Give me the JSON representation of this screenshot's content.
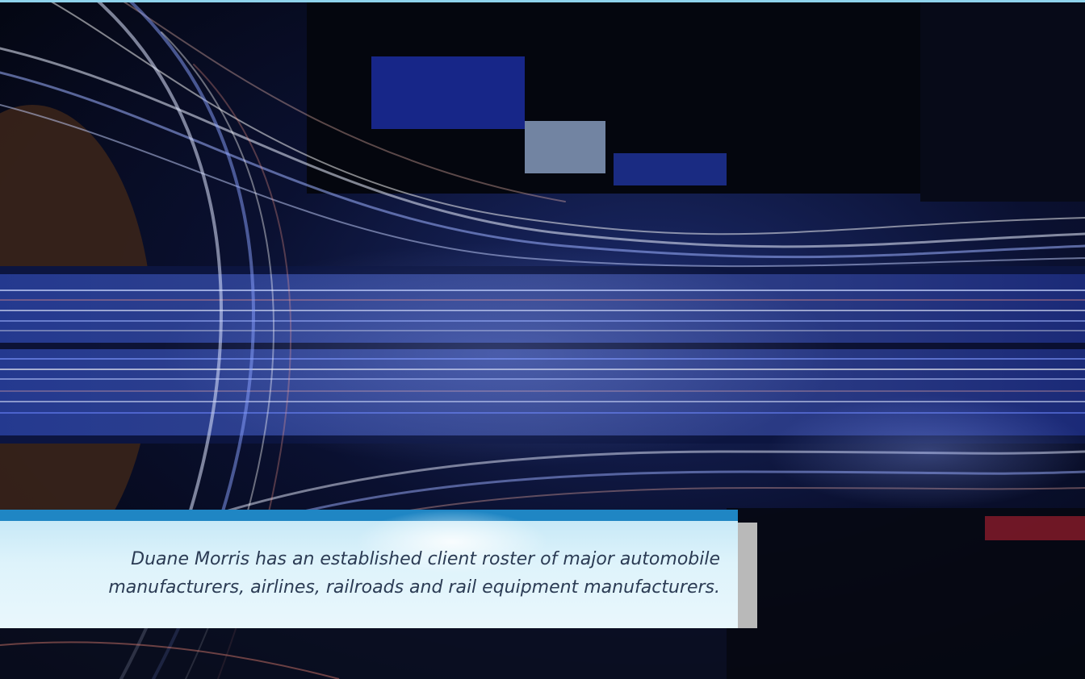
{
  "quote": {
    "line1": "Duane Morris has an established client roster of major automobile",
    "line2": "manufacturers, airlines, railroads and rail equipment manufacturers."
  },
  "colors": {
    "accent_bar": "#1f86c4",
    "quote_panel": "#def3fb",
    "quote_text": "#2b3b54",
    "top_rule": "#8fd3ec"
  }
}
